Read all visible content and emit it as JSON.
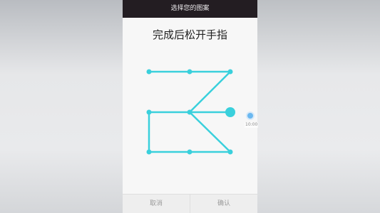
{
  "status_bar": {
    "title": "选择您的图案"
  },
  "prompt": {
    "text": "完成后松开手指"
  },
  "pattern": {
    "accent_color": "#3ad0dc",
    "grid_size": 3,
    "path": [
      [
        0,
        0
      ],
      [
        0,
        1
      ],
      [
        0,
        2
      ],
      [
        1,
        1
      ],
      [
        1,
        0
      ],
      [
        2,
        0
      ],
      [
        2,
        1
      ],
      [
        2,
        2
      ],
      [
        1,
        1
      ],
      [
        1,
        2
      ]
    ],
    "end_dot": [
      1,
      2
    ]
  },
  "bottom_bar": {
    "cancel_label": "取消",
    "confirm_label": "确认"
  },
  "floating_button": {
    "label": "10:00"
  }
}
